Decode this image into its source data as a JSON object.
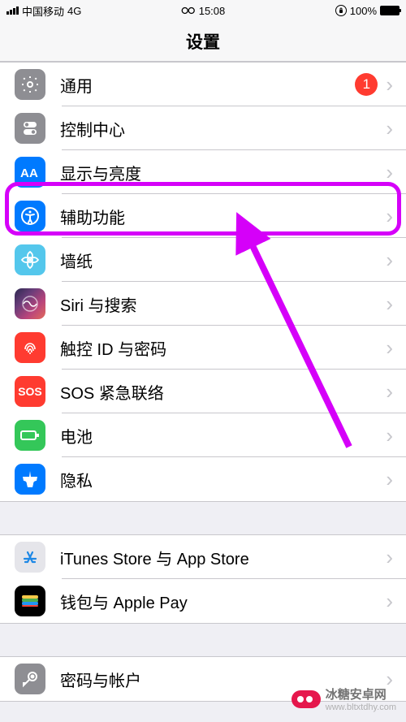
{
  "status": {
    "carrier": "中国移动",
    "network": "4G",
    "time": "15:08",
    "battery_pct": "100%"
  },
  "nav": {
    "title": "设置"
  },
  "groups": [
    {
      "items": [
        {
          "icon": "general-icon",
          "label": "通用",
          "badge": "1"
        },
        {
          "icon": "control-center-icon",
          "label": "控制中心"
        },
        {
          "icon": "display-icon",
          "label": "显示与亮度",
          "highlighted": true
        },
        {
          "icon": "accessibility-icon",
          "label": "辅助功能"
        },
        {
          "icon": "wallpaper-icon",
          "label": "墙纸"
        },
        {
          "icon": "siri-icon",
          "label": "Siri 与搜索"
        },
        {
          "icon": "touchid-icon",
          "label": "触控 ID 与密码"
        },
        {
          "icon": "sos-icon",
          "label": "SOS 紧急联络"
        },
        {
          "icon": "battery-icon",
          "label": "电池"
        },
        {
          "icon": "privacy-icon",
          "label": "隐私"
        }
      ]
    },
    {
      "items": [
        {
          "icon": "itunes-icon",
          "label": "iTunes Store 与 App Store"
        },
        {
          "icon": "wallet-icon",
          "label": "钱包与 Apple Pay"
        }
      ]
    },
    {
      "items": [
        {
          "icon": "account-icon",
          "label": "密码与帐户"
        }
      ]
    }
  ],
  "sos_label": "SOS",
  "watermark": {
    "text": "冰糖安卓网",
    "url": "www.bltxtdhy.com"
  }
}
